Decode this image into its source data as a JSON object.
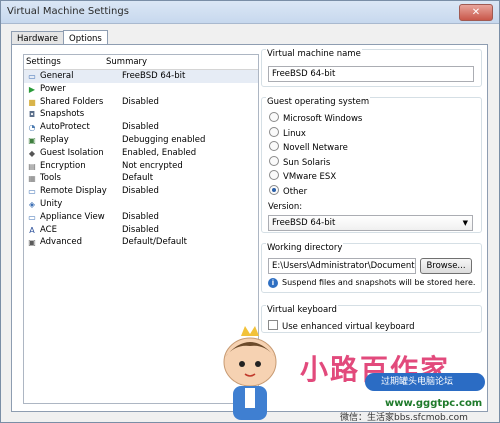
{
  "window": {
    "title": "Virtual Machine Settings",
    "close_label": "✕"
  },
  "tabs": [
    {
      "label": "Hardware"
    },
    {
      "label": "Options"
    }
  ],
  "list": {
    "headers": {
      "settings": "Settings",
      "summary": "Summary"
    },
    "items": [
      {
        "name": "General",
        "summary": "FreeBSD 64-bit",
        "icon": "general-icon",
        "glyph": "▭",
        "color": "#3a6db3"
      },
      {
        "name": "Power",
        "summary": "",
        "icon": "power-icon",
        "glyph": "▶",
        "color": "#2b9b3a"
      },
      {
        "name": "Shared Folders",
        "summary": "Disabled",
        "icon": "folder-icon",
        "glyph": "■",
        "color": "#d9b44a"
      },
      {
        "name": "Snapshots",
        "summary": "",
        "icon": "snapshot-icon",
        "glyph": "◘",
        "color": "#5a6e8a"
      },
      {
        "name": "AutoProtect",
        "summary": "Disabled",
        "icon": "clock-icon",
        "glyph": "◔",
        "color": "#4a7ab0"
      },
      {
        "name": "Replay",
        "summary": "Debugging enabled",
        "icon": "replay-icon",
        "glyph": "▣",
        "color": "#3f7f3f"
      },
      {
        "name": "Guest Isolation",
        "summary": "Enabled, Enabled",
        "icon": "isolation-icon",
        "glyph": "◆",
        "color": "#555555"
      },
      {
        "name": "Encryption",
        "summary": "Not encrypted",
        "icon": "lock-icon",
        "glyph": "▤",
        "color": "#6b6b6b"
      },
      {
        "name": "Tools",
        "summary": "Default",
        "icon": "tools-icon",
        "glyph": "▦",
        "color": "#7a7a7a"
      },
      {
        "name": "Remote Display",
        "summary": "Disabled",
        "icon": "monitor-icon",
        "glyph": "▭",
        "color": "#3a6db3"
      },
      {
        "name": "Unity",
        "summary": "",
        "icon": "unity-icon",
        "glyph": "◈",
        "color": "#3a6db3"
      },
      {
        "name": "Appliance View",
        "summary": "Disabled",
        "icon": "appliance-icon",
        "glyph": "▭",
        "color": "#3a6db3"
      },
      {
        "name": "ACE",
        "summary": "Disabled",
        "icon": "ace-icon",
        "glyph": "A",
        "color": "#2b4f9a"
      },
      {
        "name": "Advanced",
        "summary": "Default/Default",
        "icon": "advanced-icon",
        "glyph": "▣",
        "color": "#5a5a5a"
      }
    ]
  },
  "vm_name": {
    "label": "Virtual machine name",
    "value": "FreeBSD 64-bit"
  },
  "guest_os": {
    "label": "Guest operating system",
    "options": [
      {
        "label": "Microsoft Windows",
        "selected": false
      },
      {
        "label": "Linux",
        "selected": false
      },
      {
        "label": "Novell Netware",
        "selected": false
      },
      {
        "label": "Sun Solaris",
        "selected": false
      },
      {
        "label": "VMware ESX",
        "selected": false
      },
      {
        "label": "Other",
        "selected": true
      }
    ],
    "version_label": "Version:",
    "version_value": "FreeBSD 64-bit"
  },
  "working_dir": {
    "label": "Working directory",
    "value": "E:\\Users\\Administrator\\Documents\\Vir",
    "browse_label": "Browse...",
    "info_text": "Suspend files and snapshots will be stored here."
  },
  "keyboard": {
    "label": "Virtual keyboard",
    "checkbox_label": "Use enhanced virtual keyboard",
    "checked": false
  },
  "watermark": {
    "brand": "小路百作家",
    "forum": "过期罐头电脑论坛",
    "site": "www.gggtpc.com",
    "caption": "微信：生活家bbs.sfcmob.com"
  }
}
